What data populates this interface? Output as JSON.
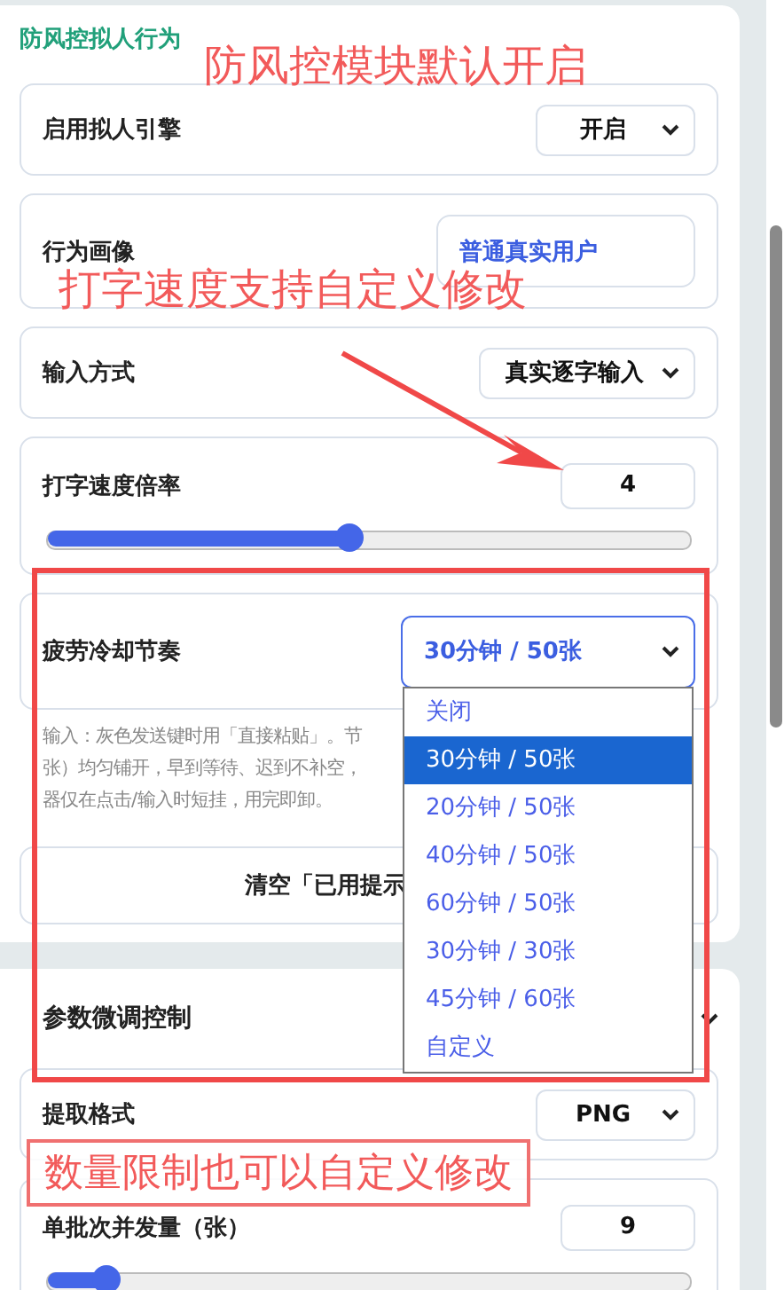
{
  "sections": [
    {
      "title": "防风控拟人行为",
      "kind": "accent",
      "rows": [
        {
          "kind": "select",
          "label": "启用拟人引擎",
          "value": "开启"
        },
        {
          "kind": "field",
          "label": "行为画像",
          "value": "普通真实用户"
        },
        {
          "kind": "select",
          "label": "输入方式",
          "value": "真实逐字输入"
        },
        {
          "kind": "slider",
          "label": "打字速度倍率",
          "value": "4",
          "level": 0.47
        },
        {
          "kind": "select",
          "label": "疲劳冷却节奏",
          "value": "30分钟 / 50张",
          "focused": true,
          "expanded": true,
          "options": [
            {
              "label": "关闭",
              "selected": false
            },
            {
              "label": "30分钟 / 50张",
              "selected": true
            },
            {
              "label": "20分钟 / 50张",
              "selected": false
            },
            {
              "label": "40分钟 / 50张",
              "selected": false
            },
            {
              "label": "60分钟 / 50张",
              "selected": false
            },
            {
              "label": "30分钟 / 30张",
              "selected": false
            },
            {
              "label": "45分钟 / 60张",
              "selected": false
            },
            {
              "label": "自定义",
              "selected": false
            }
          ]
        }
      ],
      "hint": [
        "输入：灰色发送键时用「直接粘贴」。节",
        "张）均匀铺开，早到等待、迟到不补空，",
        "器仅在点击/输入时短挂，用完即卸。"
      ],
      "button": "清空「已用提示"
    },
    {
      "title": "参数微调控制",
      "kind": "collapsible",
      "rows": [
        {
          "kind": "select",
          "label": "提取格式",
          "value": "PNG"
        },
        {
          "kind": "slider",
          "label": "单批次并发量（张）",
          "value": "9",
          "level": 0.09
        }
      ]
    }
  ],
  "annotations": [
    {
      "kind": "text",
      "text": "防风控模块默认开启"
    },
    {
      "kind": "text",
      "text": "打字速度支持自定义修改"
    },
    {
      "kind": "arrow"
    },
    {
      "kind": "frame"
    },
    {
      "kind": "boxed_text",
      "text": "数量限制也可以自定义修改"
    }
  ]
}
